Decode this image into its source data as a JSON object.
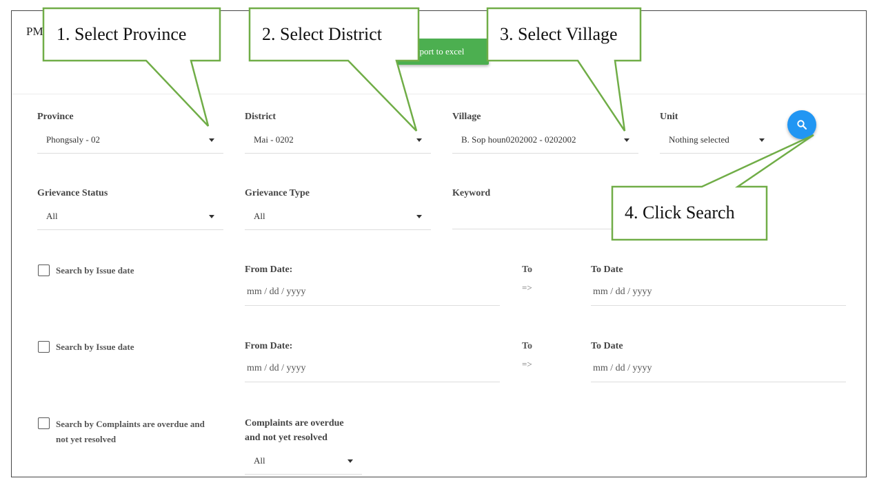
{
  "header": {
    "title_partial": "PM",
    "export_label": "Export to excel"
  },
  "filters": {
    "province": {
      "label": "Province",
      "value": "Phongsaly - 02"
    },
    "district": {
      "label": "District",
      "value": "Mai - 0202"
    },
    "village": {
      "label": "Village",
      "value": "B. Sop houn0202002 - 0202002"
    },
    "unit": {
      "label": "Unit",
      "value": "Nothing selected"
    },
    "grievance_status": {
      "label": "Grievance Status",
      "value": "All"
    },
    "grievance_type": {
      "label": "Grievance Type",
      "value": "All"
    },
    "keyword": {
      "label": "Keyword",
      "value": ""
    },
    "search_icon": "search-icon"
  },
  "date_rows": [
    {
      "checkbox_label": "Search by Issue date",
      "from_label": "From Date:",
      "from_placeholder": "mm / dd / yyyy",
      "to_text": "To",
      "arrow": "=>",
      "to_label": "To Date",
      "to_placeholder": "mm / dd / yyyy"
    },
    {
      "checkbox_label": "Search by Issue date",
      "from_label": "From Date:",
      "from_placeholder": "mm / dd / yyyy",
      "to_text": "To",
      "arrow": "=>",
      "to_label": "To Date",
      "to_placeholder": "mm / dd / yyyy"
    }
  ],
  "overdue": {
    "checkbox_label_line1": "Search by Complaints are overdue and",
    "checkbox_label_line2": "not yet resolved",
    "select_label_line1": "Complaints are overdue",
    "select_label_line2": "and not yet resolved",
    "value": "All"
  },
  "callouts": [
    {
      "text": "1. Select Province"
    },
    {
      "text": "2. Select District"
    },
    {
      "text": "3. Select Village"
    },
    {
      "text": "4. Click Search"
    }
  ],
  "colors": {
    "accent_blue": "#2196f3",
    "export_green": "#4caf50",
    "callout_border": "#70ad47"
  }
}
